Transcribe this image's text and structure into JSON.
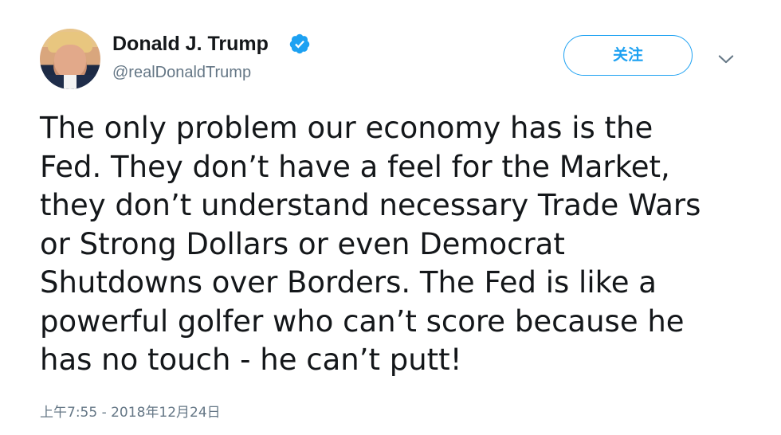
{
  "tweet": {
    "author": {
      "display_name": "Donald J. Trump",
      "username": "@realDonaldTrump",
      "verified_icon": "verified-badge-icon",
      "avatar_icon": "profile-photo"
    },
    "follow_label": "关注",
    "more_icon": "chevron-down-icon",
    "text_lines": [
      "The only problem our economy has is the",
      "Fed. They don’t have a feel for the Market,",
      "they don’t understand necessary Trade Wars",
      "or Strong Dollars or even Democrat",
      "Shutdowns over Borders. The Fed is like a",
      "powerful golfer who can’t score because he",
      "has no touch - he can’t putt!"
    ],
    "timestamp": "上午7:55 - 2018年12月24日"
  },
  "colors": {
    "accent": "#1da1f2",
    "text": "#14171a",
    "secondary_text": "#657786",
    "background": "#ffffff"
  }
}
